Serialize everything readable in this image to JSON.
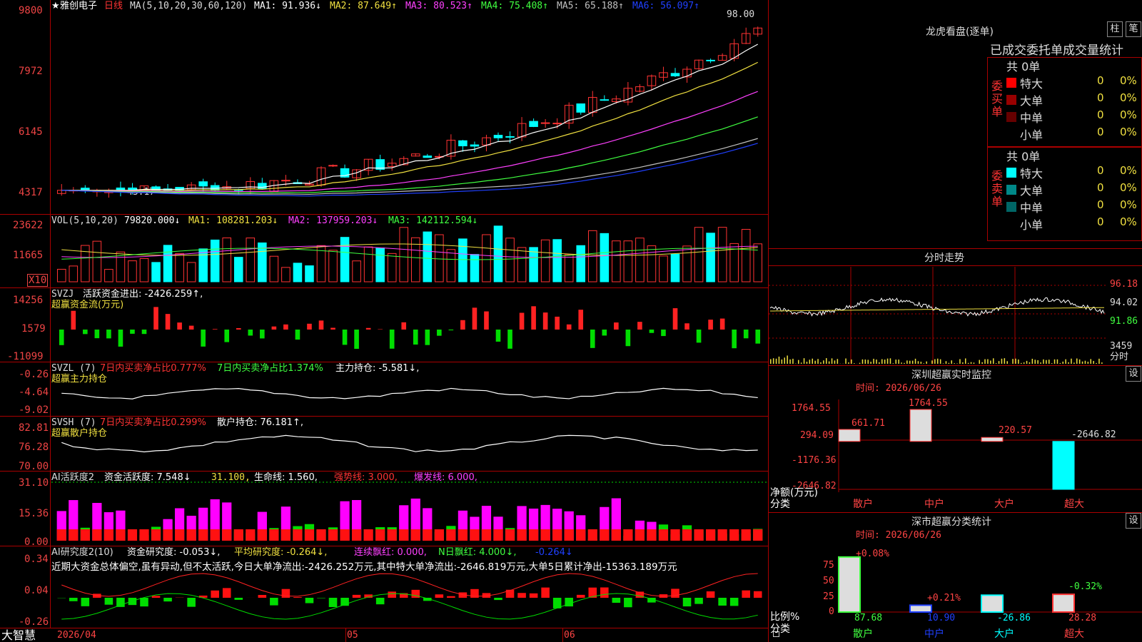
{
  "main": {
    "title_star": "★",
    "stock_name": "雅创电子",
    "period": "日线",
    "ma_label": "MA(5,10,20,30,60,120)",
    "ma_values": [
      {
        "label": "MA1: 91.936↓",
        "color": "#ffffff"
      },
      {
        "label": "MA2: 87.649↑",
        "color": "#f0e040"
      },
      {
        "label": "MA3: 80.523↑",
        "color": "#ff40ff"
      },
      {
        "label": "MA4: 75.408↑",
        "color": "#40ff40"
      },
      {
        "label": "MA5: 65.188↑",
        "color": "#c0c0c0"
      },
      {
        "label": "MA6: 56.097↑",
        "color": "#2040ff"
      }
    ],
    "y_ticks": [
      "9800",
      "7972",
      "6145",
      "4317"
    ],
    "high_label": "98.00",
    "low_label": "43.17"
  },
  "vol": {
    "header": "VOL(5,10,20)",
    "value": "79820.000↓",
    "ma1": "MA1: 108281.203↓",
    "ma2": "MA2: 137959.203↓",
    "ma3": "MA3: 142112.594↓",
    "y_ticks": [
      "23622",
      "11665"
    ],
    "unit": "X10"
  },
  "svzj": {
    "header": "SVZJ",
    "label": "活跃资金进出: -2426.259↑,",
    "subtitle": "超赢资金流(万元)",
    "y_ticks": [
      "14256",
      "1579",
      "-11099"
    ]
  },
  "svzl": {
    "header": "SVZL (7)",
    "l1": "7日内买卖净占比0.777%",
    "l2": "7日内买卖净占比1.374%",
    "l3": "主力持仓: -5.581↓,",
    "subtitle": "超赢主力持仓",
    "y_ticks": [
      "-0.26",
      "-4.64",
      "-9.02"
    ]
  },
  "svsh": {
    "header": "SVSH (7)",
    "l1": "7日内买卖净占比0.299%",
    "l2": "散户持仓: 76.181↑,",
    "subtitle": "超赢散户持仓",
    "y_ticks": [
      "82.81",
      "76.28",
      "70.00"
    ]
  },
  "ai1": {
    "header": "AI活跃度2",
    "l1": "资金活跃度: 7.548↓",
    "l2": "31.100,",
    "l3": "生命线: 1.560,",
    "l4": "强势线: 3.000,",
    "l5": "爆发线: 6.000,",
    "y_ticks": [
      "31.10",
      "15.36",
      "0.00"
    ]
  },
  "ai2": {
    "header": "AI研究度2(10)",
    "l1": "资金研究度: -0.053↓,",
    "l2": "平均研究度: -0.264↓,",
    "l3": "连续飘红: 0.000,",
    "l4": "N日飘红: 4.000↓,",
    "l5": "-0.264↓",
    "summary": "近期大资金总体偏空,虽有异动,但不太活跃,今日大单净流出:-2426.252万元,其中特大单净流出:-2646.819万元,大单5日累计净出-15363.189万元",
    "y_ticks": [
      "0.34",
      "0.04",
      "-0.26"
    ]
  },
  "xaxis": {
    "brand": "大智慧",
    "date0": "2026/04",
    "m1": "05",
    "m2": "06"
  },
  "right": {
    "lh_title": "龙虎看盘(逐单)",
    "btn_zhu": "柱",
    "btn_bi": "笔",
    "tabs": "已成交委托单成交量统计",
    "buy": {
      "side_label": "委买单",
      "total": "共 0单",
      "rows": [
        {
          "name": "特大",
          "vol": "0",
          "pct": "0%",
          "color": "#ff0000"
        },
        {
          "name": "大单",
          "vol": "0",
          "pct": "0%",
          "color": "#990000"
        },
        {
          "name": "中单",
          "vol": "0",
          "pct": "0%",
          "color": "#660000"
        },
        {
          "name": "小单",
          "vol": "0",
          "pct": "0%",
          "color": "#000000"
        }
      ]
    },
    "sell": {
      "side_label": "委卖单",
      "total": "共 0单",
      "rows": [
        {
          "name": "特大",
          "vol": "0",
          "pct": "0%",
          "color": "#00ffff"
        },
        {
          "name": "大单",
          "vol": "0",
          "pct": "0%",
          "color": "#008888"
        },
        {
          "name": "中单",
          "vol": "0",
          "pct": "0%",
          "color": "#006666"
        },
        {
          "name": "小单",
          "vol": "0",
          "pct": "0%",
          "color": "#000000"
        }
      ]
    },
    "intraday": {
      "title": "分时走势",
      "y_ticks": [
        "96.18",
        "94.02",
        "91.86"
      ],
      "vol_tick": "3459",
      "vol_label": "分时"
    },
    "monitor": {
      "title": "深圳超赢实时监控",
      "btn": "设",
      "time": "时间: 2026/06/26",
      "y_ticks": [
        "1764.55",
        "294.09",
        "-1176.36",
        "-2646.82"
      ],
      "ylabel1": "净额(万元)",
      "ylabel2": "分类",
      "cats": [
        "散户",
        "中户",
        "大户",
        "超大"
      ],
      "values": [
        661.71,
        1764.55,
        220.57,
        -2646.82
      ],
      "value_labels": [
        "661.71",
        "1764.55",
        "220.57",
        "-2646.82"
      ]
    },
    "classify": {
      "title": "深市超赢分类统计",
      "btn": "设",
      "time": "时间: 2026/06/26",
      "y_ticks": [
        "75",
        "50",
        "25",
        "0"
      ],
      "ylabel1": "比例%",
      "ylabel2": "分类",
      "cats": [
        "散户",
        "中户",
        "大户",
        "超大"
      ],
      "ratios": [
        87.68,
        10.9,
        -26.86,
        28.28
      ],
      "ratio_labels": [
        "87.68",
        "10.90",
        "-26.86",
        "28.28"
      ],
      "changes": [
        "+0.08%",
        "+0.21%",
        "",
        "-0.32%"
      ]
    }
  },
  "chart_data": [
    {
      "type": "candlestick",
      "title": "雅创电子 日线",
      "series_name": "price",
      "ylim": [
        43.17,
        98.0
      ],
      "high": 98.0,
      "low": 43.17,
      "ma": {
        "MA1": 91.936,
        "MA2": 87.649,
        "MA3": 80.523,
        "MA4": 75.408,
        "MA5": 65.188,
        "MA6": 56.097
      }
    },
    {
      "type": "bar",
      "title": "VOL(5,10,20)",
      "last": 79820.0,
      "ma": {
        "MA1": 108281.203,
        "MA2": 137959.203,
        "MA3": 142112.594
      }
    },
    {
      "type": "bar",
      "title": "SVZJ",
      "last": -2426.259
    },
    {
      "type": "line",
      "title": "SVZL (7)",
      "last": -5.581
    },
    {
      "type": "line",
      "title": "SVSH (7)",
      "last": 76.181
    },
    {
      "type": "bar",
      "title": "AI活跃度2",
      "last": 7.548
    },
    {
      "type": "bar",
      "title": "AI研究度2(10)",
      "last": -0.053,
      "avg": -0.264
    }
  ]
}
